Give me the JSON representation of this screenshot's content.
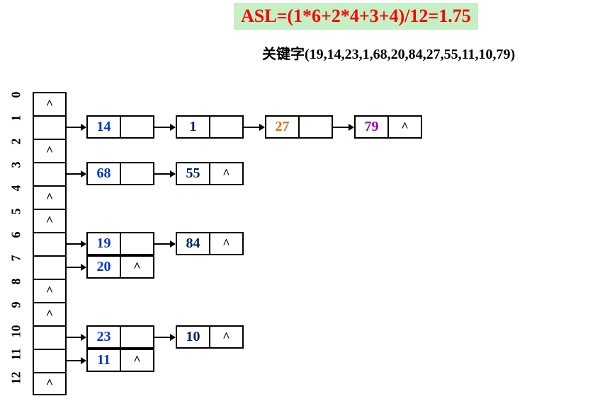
{
  "formula": "ASL=(1*6+2*4+3+4)/12=1.75",
  "keywords": {
    "label": "关键字",
    "values": "(19,14,23,1,68,20,84,27,55,11,10,79)"
  },
  "caret": "^",
  "buckets": [
    {
      "index": "0",
      "empty": true
    },
    {
      "index": "1",
      "chain": [
        {
          "val": "14",
          "cls": "c-blue",
          "end": false
        },
        {
          "val": "1",
          "cls": "c-dblue",
          "end": false
        },
        {
          "val": "27",
          "cls": "c-orange",
          "end": false
        },
        {
          "val": "79",
          "cls": "c-purple",
          "end": true
        }
      ]
    },
    {
      "index": "2",
      "empty": true
    },
    {
      "index": "3",
      "chain": [
        {
          "val": "68",
          "cls": "c-blue",
          "end": false
        },
        {
          "val": "55",
          "cls": "c-dblue",
          "end": true
        }
      ]
    },
    {
      "index": "4",
      "empty": true
    },
    {
      "index": "5",
      "empty": true
    },
    {
      "index": "6",
      "chain": [
        {
          "val": "19",
          "cls": "c-blue",
          "end": false
        },
        {
          "val": "84",
          "cls": "c-dblue",
          "end": true
        }
      ]
    },
    {
      "index": "7",
      "chain": [
        {
          "val": "20",
          "cls": "c-blue",
          "end": true
        }
      ]
    },
    {
      "index": "8",
      "empty": true
    },
    {
      "index": "9",
      "empty": true
    },
    {
      "index": "10",
      "chain": [
        {
          "val": "23",
          "cls": "c-blue",
          "end": false
        },
        {
          "val": "10",
          "cls": "c-dblue",
          "end": true
        }
      ]
    },
    {
      "index": "11",
      "chain": [
        {
          "val": "11",
          "cls": "c-blue",
          "end": true
        }
      ]
    },
    {
      "index": "12",
      "empty": true
    }
  ]
}
